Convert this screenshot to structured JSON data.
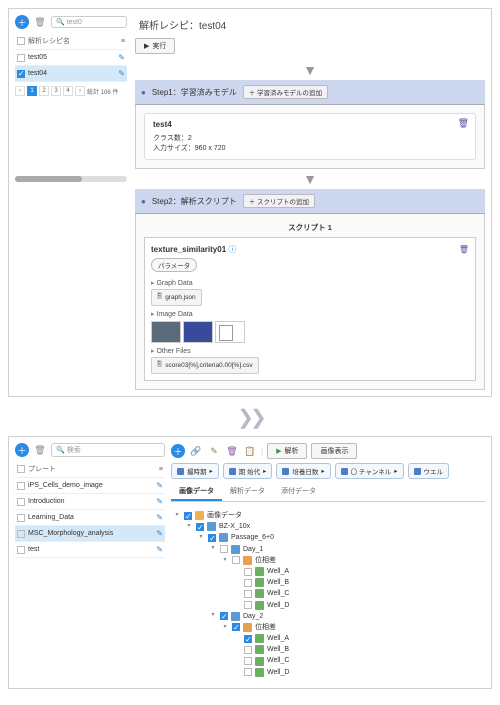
{
  "top": {
    "search_placeholder": "test0",
    "title": "解析レシピ：test04",
    "recipe_list": {
      "header": "解析レシピ名",
      "sort_icon": "≡",
      "rows": [
        {
          "name": "test05",
          "checked": false,
          "selected": false
        },
        {
          "name": "test04",
          "checked": true,
          "selected": true
        }
      ],
      "pager": {
        "pages": [
          "1",
          "2",
          "3",
          "4"
        ],
        "current": "1",
        "total_label": "総計 106 件"
      }
    },
    "run_btn": "実行",
    "step1": {
      "label": "Step1：学習済みモデル",
      "add_btn": "＋ 学習済みモデルの追加",
      "model": {
        "name": "test4",
        "class_line": "クラス数：2",
        "size_line": "入力サイズ：960 x 720"
      }
    },
    "step2": {
      "label": "Step2：解析スクリプト",
      "add_btn": "＋ スクリプトの追加",
      "script_title": "スクリプト 1",
      "script_name": "texture_similarity01",
      "param_btn": "パラメータ",
      "sect_graph": "Graph Data",
      "file_graph": "graph.json",
      "sect_image": "Image Data",
      "sect_other": "Other Files",
      "file_other": "score03[%],criteria0.00[%].csv"
    }
  },
  "bottom": {
    "sidebar": {
      "search_placeholder": "検索",
      "header": "プレート",
      "rows": [
        {
          "name": "iPS_Cells_demo_image",
          "selected": false
        },
        {
          "name": "Introduction",
          "selected": false
        },
        {
          "name": "Learning_Data",
          "selected": false
        },
        {
          "name": "MSC_Morphology_analysis",
          "selected": true
        },
        {
          "name": "test",
          "selected": false
        }
      ]
    },
    "toolbar": {
      "analyze_btn": "解析",
      "image_display_btn": "画像表示",
      "pills": [
        "撮時期",
        "期 始代",
        "培養日数",
        "〇 チャンネル",
        "ウエル"
      ]
    },
    "tabs": {
      "image": "画像データ",
      "analysis": "解析データ",
      "attach": "添付データ"
    },
    "tree": {
      "root": "画像データ",
      "l1": "BZ-X_10x",
      "l2": "Passage_6+0",
      "day1": "Day_1",
      "phase": "位相差",
      "wells": [
        "Well_A",
        "Well_B",
        "Well_C",
        "Well_D"
      ],
      "day2": "Day_2"
    }
  }
}
